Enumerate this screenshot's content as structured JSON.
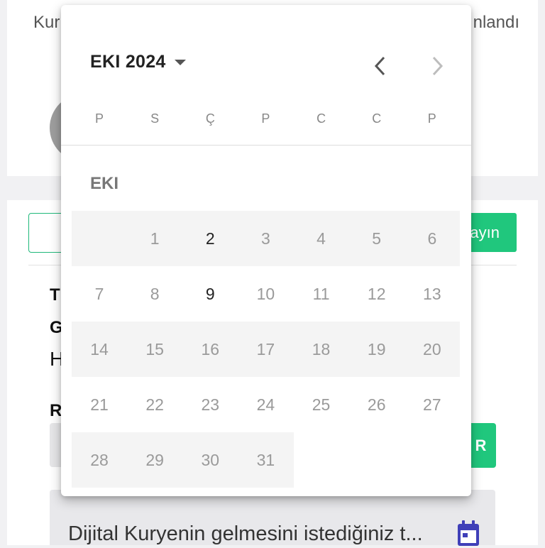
{
  "background": {
    "top_left_text": "Kur",
    "top_right_text": "nlandı",
    "action_button_label": "ayın",
    "form_letters": {
      "t": "T",
      "g": "G",
      "h": "H",
      "r": "R"
    },
    "action_button2_label": "R",
    "date_field": {
      "placeholder": "Dijital Kuryenin gelmesini istediğiniz t...",
      "icon": "calendar-icon"
    },
    "accent_color": "#20c77d"
  },
  "picker": {
    "month_year_label": "EKI 2024",
    "dropdown_icon": "caret-down-icon",
    "prev_icon": "chevron-left-icon",
    "next_icon": "chevron-right-icon",
    "weekdays": [
      "P",
      "S",
      "Ç",
      "P",
      "C",
      "C",
      "P"
    ],
    "month_label": "EKI",
    "weeks": [
      {
        "days": [
          null,
          "1",
          "2",
          "3",
          "4",
          "5",
          "6"
        ],
        "band": [
          0,
          7
        ]
      },
      {
        "days": [
          "7",
          "8",
          "9",
          "10",
          "11",
          "12",
          "13"
        ],
        "band": null
      },
      {
        "days": [
          "14",
          "15",
          "16",
          "17",
          "18",
          "19",
          "20"
        ],
        "band": [
          0,
          7
        ]
      },
      {
        "days": [
          "21",
          "22",
          "23",
          "24",
          "25",
          "26",
          "27"
        ],
        "band": null
      },
      {
        "days": [
          "28",
          "29",
          "30",
          "31"
        ],
        "band": [
          0,
          4
        ]
      }
    ],
    "enabled_days": [
      "2",
      "9"
    ]
  }
}
